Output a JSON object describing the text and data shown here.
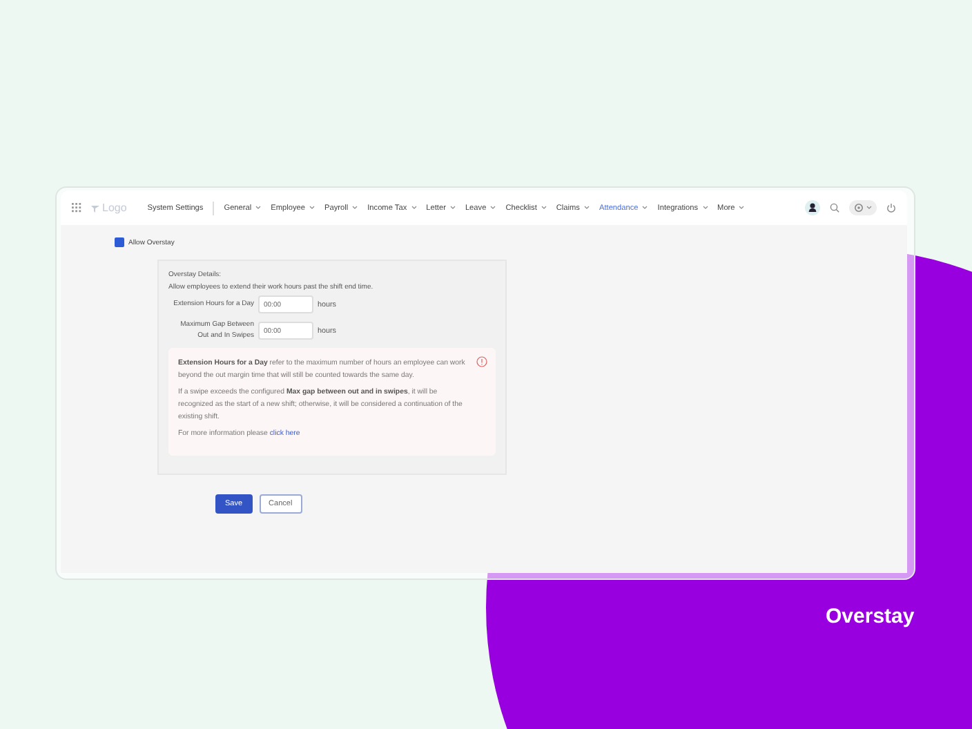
{
  "nav": {
    "logo": "Logo",
    "items": [
      {
        "label": "System Settings",
        "kind": "link",
        "selected": false
      },
      {
        "label": "General",
        "kind": "dropdown",
        "selected": false
      },
      {
        "label": "Employee",
        "kind": "dropdown",
        "selected": false
      },
      {
        "label": "Payroll",
        "kind": "dropdown",
        "selected": false
      },
      {
        "label": "Income Tax",
        "kind": "dropdown",
        "selected": false
      },
      {
        "label": "Letter",
        "kind": "dropdown",
        "selected": false
      },
      {
        "label": "Leave",
        "kind": "dropdown",
        "selected": false
      },
      {
        "label": "Checklist",
        "kind": "dropdown",
        "selected": false
      },
      {
        "label": "Claims",
        "kind": "dropdown",
        "selected": false
      },
      {
        "label": "Attendance",
        "kind": "dropdown",
        "selected": true
      },
      {
        "label": "Integrations",
        "kind": "dropdown",
        "selected": false
      },
      {
        "label": "More",
        "kind": "dropdown",
        "selected": false
      }
    ]
  },
  "allow_overstay": {
    "label": "Allow Overstay",
    "checked": true
  },
  "details": {
    "title": "Overstay Details:",
    "description": "Allow employees to extend their work hours past the shift end time.",
    "fields": [
      {
        "label": "Extension Hours for a Day",
        "value": "00:00",
        "unit": "hours"
      },
      {
        "label": "Maximum Gap Between Out and In Swipes",
        "value": "00:00",
        "unit": "hours"
      }
    ],
    "info": {
      "paragraphs": [
        "**Extension Hours for a Day** refer to the maximum number of hours an employee can work beyond the out margin time that will still be counted towards the same day.",
        "If a swipe exceeds the configured **Max gap between out and in swipes**, it will be recognized as the start of a new shift; otherwise, it will be considered a continuation of the existing shift."
      ],
      "more_text": "For more information please",
      "link": "click here"
    }
  },
  "buttons": {
    "save": "Save",
    "cancel": "Cancel"
  },
  "caption": "Overstay"
}
